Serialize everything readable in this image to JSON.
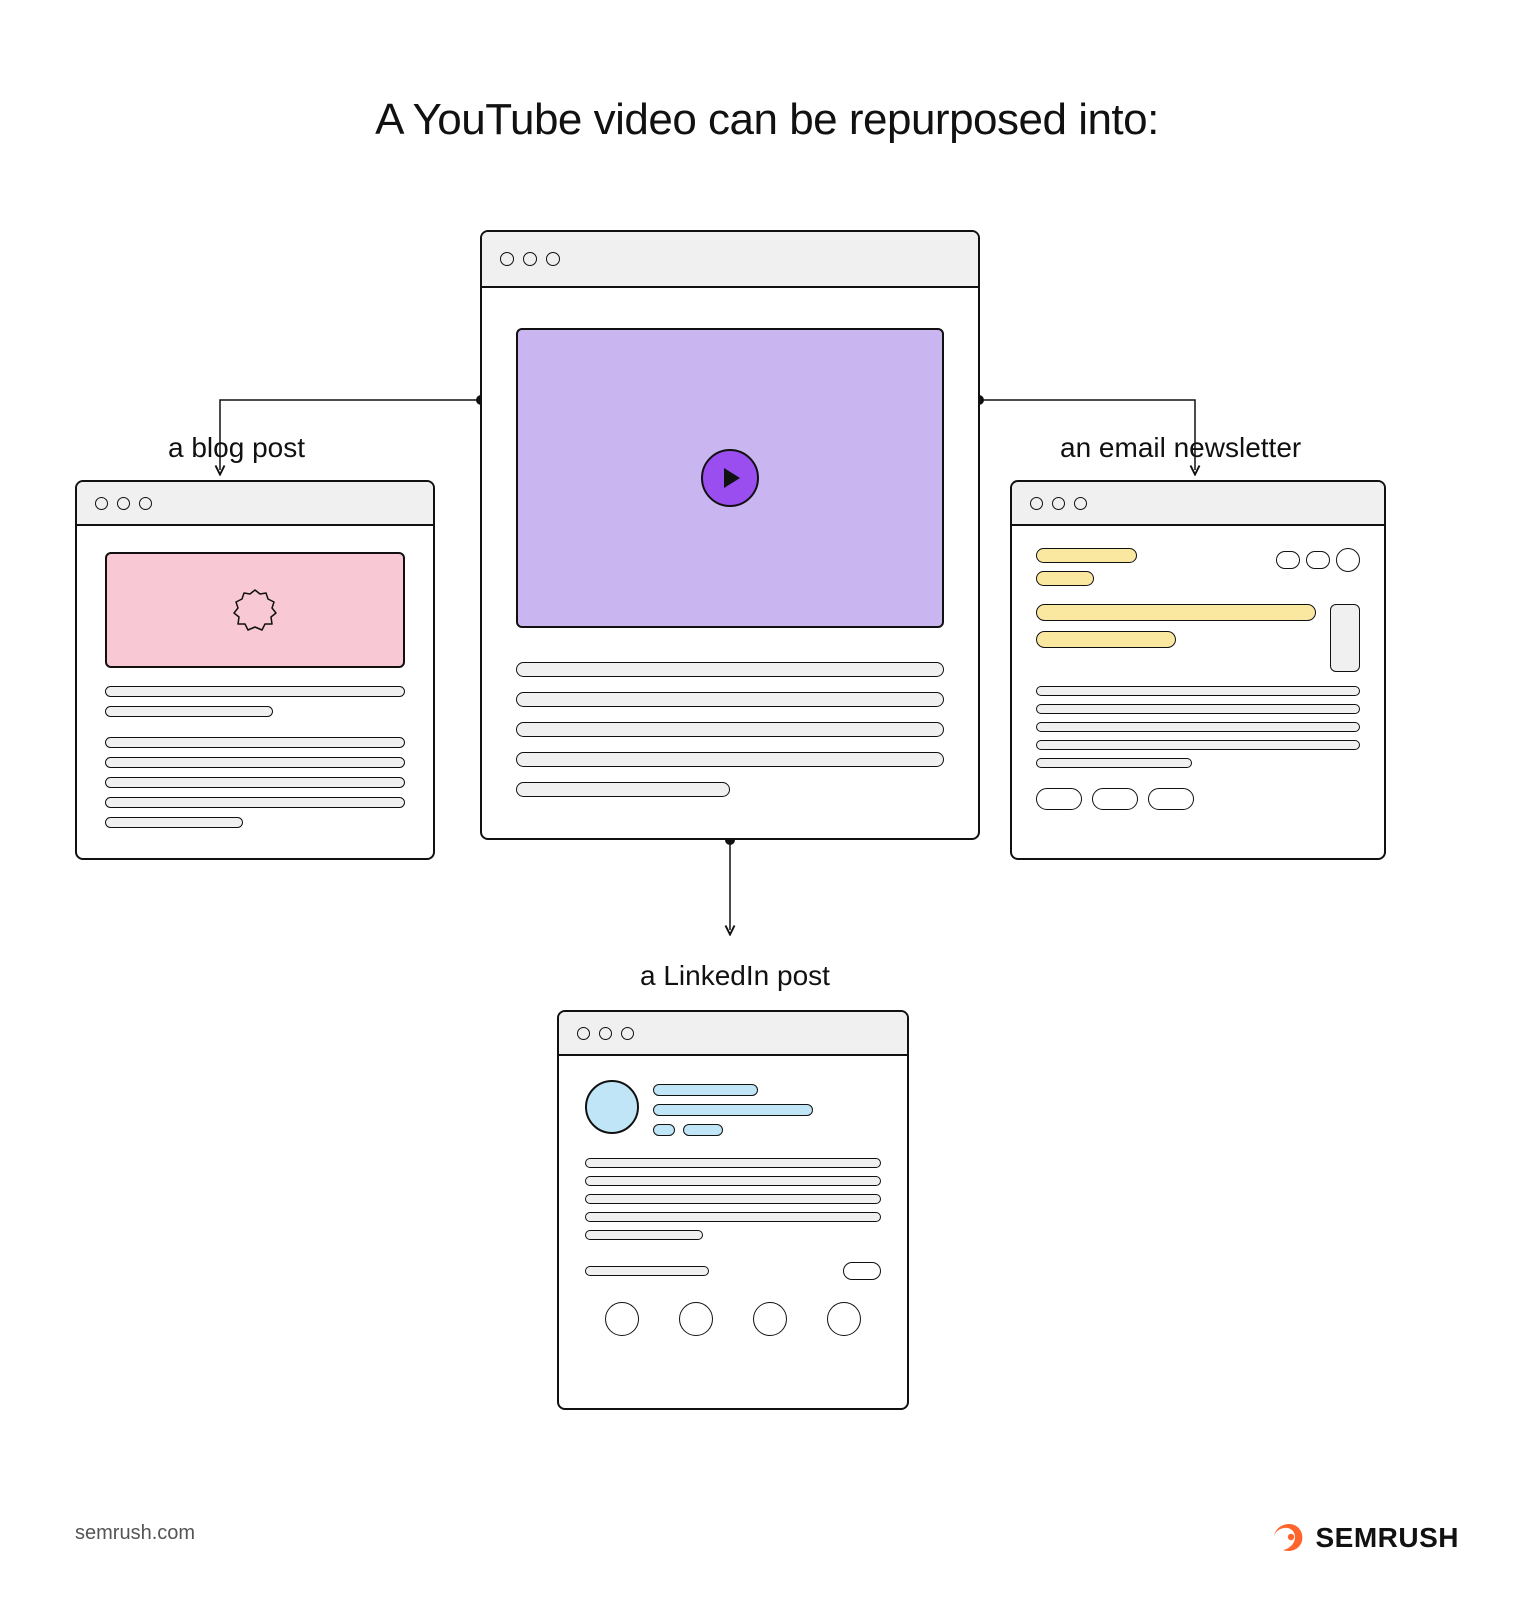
{
  "title": "A YouTube video can be repurposed into:",
  "labels": {
    "blog": "a blog post",
    "email": "an email newsletter",
    "linkedin": "a LinkedIn post"
  },
  "footer": {
    "url": "semrush.com",
    "brand": "SEMRUSH"
  },
  "colors": {
    "video_bg": "#c9b6f0",
    "play_btn": "#9a4ef0",
    "blog_hero": "#f8c9d4",
    "email_highlight": "#fbe8a0",
    "linkedin_accent": "#bfe5f7",
    "brand_orange": "#ff642d"
  }
}
